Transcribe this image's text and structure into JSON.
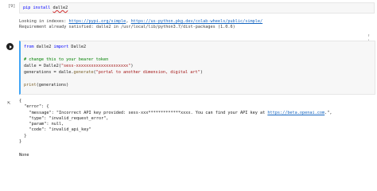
{
  "cell1": {
    "exec_count": "[9]",
    "code_pip": "pip",
    "code_install": "install",
    "code_pkg": "dalle2",
    "out_line1_prefix": "Looking in indexes: ",
    "out_line1_link1": "https://pypi.org/simple",
    "out_line1_sep": ", ",
    "out_line1_link2": "https://us-python.pkg.dev/colab-wheels/public/simple/",
    "out_line2": "Requirement already satisfied: dalle2 in /usr/local/lib/python3.7/dist-packages (1.0.6)"
  },
  "cell2": {
    "line1_from": "from",
    "line1_mod": " dalle2 ",
    "line1_import": "import",
    "line1_name": " Dalle2",
    "line2": "# change this to your bearer token",
    "line3_pre": "dalle = Dalle2(",
    "line3_str": "\"sess-xxxxxxxxxxxxxxxxxxxxx\"",
    "line3_post": ")",
    "line4_pre": "generations = dalle.",
    "line4_fn": "generate",
    "line4_open": "(",
    "line4_str": "\"portal to another dimension, digital art\"",
    "line4_close": ")",
    "line5_fn": "print",
    "line5_rest": "(generations)"
  },
  "output2": {
    "l1": "{",
    "l2": "  \"error\": {",
    "l3_pre": "    \"message\": \"Incorrect API key provided: sess-xxx*************xxxx. You can find your API key at ",
    "l3_link": "https://beta.openai.com",
    "l3_post": ".\",",
    "l4": "    \"type\": \"invalid_request_error\",",
    "l5": "    \"param\": null,",
    "l6": "    \"code\": \"invalid_api_key\"",
    "l7": "  }",
    "l8": "}",
    "l9": "None"
  },
  "icons": {
    "run": "play-icon",
    "output": "output-icon",
    "toolbar": [
      "arrow-up-icon",
      "arrow-down-icon",
      "link-icon"
    ]
  }
}
